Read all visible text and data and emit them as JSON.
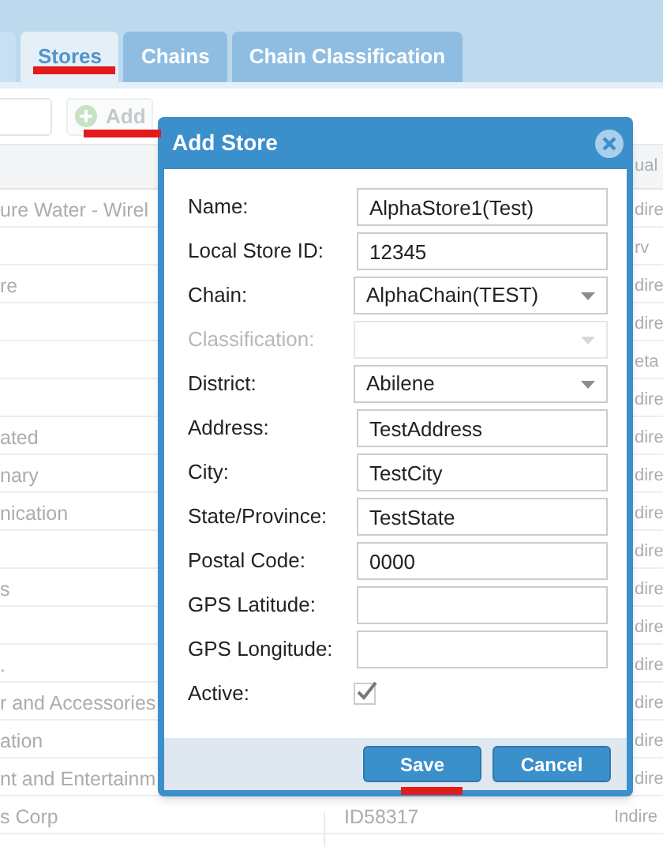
{
  "tabs": [
    {
      "label": "Stores",
      "selected": true
    },
    {
      "label": "Chains",
      "selected": false
    },
    {
      "label": "Chain Classification",
      "selected": false
    }
  ],
  "toolbar": {
    "add_button": "Add"
  },
  "grid": {
    "header_col_3": "ual",
    "rows": [
      {
        "col_1": "ure Water - Wirel",
        "col_3": "dire"
      },
      {
        "col_3": "rv"
      },
      {
        "col_1": "re",
        "col_3": "dire"
      },
      {
        "col_3": "dire"
      },
      {
        "col_3": "eta"
      },
      {
        "col_3": "dire"
      },
      {
        "col_1": "ated",
        "col_3": "dire"
      },
      {
        "col_1": "nary",
        "col_3": "dire"
      },
      {
        "col_1": "nication",
        "col_3": "dire"
      },
      {
        "col_3": "dire"
      },
      {
        "col_1": "s",
        "col_3": "dire"
      },
      {
        "col_3": "dire"
      },
      {
        "col_1": ".",
        "col_3": "dire"
      },
      {
        "col_1": "r and Accessories",
        "col_3": "dire"
      },
      {
        "col_1": "ation",
        "col_3": "dire"
      },
      {
        "col_1": "nt and Entertainm",
        "col_3": "dire"
      },
      {
        "col_1": "s Corp",
        "col_2": "ID58317",
        "col_3": "Indire"
      }
    ]
  },
  "dialog": {
    "title": "Add Store",
    "fields": [
      {
        "kind": "text",
        "label": "Name:",
        "value": "AlphaStore1(Test)",
        "disabled": false
      },
      {
        "kind": "text",
        "label": "Local Store ID:",
        "value": "12345",
        "disabled": false
      },
      {
        "kind": "select",
        "label": "Chain:",
        "value": "AlphaChain(TEST)",
        "disabled": false
      },
      {
        "kind": "select",
        "label": "Classification:",
        "disabled": true
      },
      {
        "kind": "select",
        "label": "District:",
        "value": "Abilene",
        "disabled": false
      },
      {
        "kind": "text",
        "label": "Address:",
        "value": "TestAddress",
        "disabled": false
      },
      {
        "kind": "text",
        "label": "City:",
        "value": "TestCity",
        "disabled": false
      },
      {
        "kind": "text",
        "label": "State/Province:",
        "value": "TestState",
        "disabled": false
      },
      {
        "kind": "text",
        "label": "Postal Code:",
        "value": "0000",
        "disabled": false
      },
      {
        "kind": "text",
        "label": "GPS Latitude:",
        "disabled": false
      },
      {
        "kind": "text",
        "label": "GPS Longitude:",
        "disabled": false
      },
      {
        "kind": "checkbox",
        "label": "Active:",
        "checked": true,
        "disabled": false
      }
    ],
    "buttons": [
      "Save",
      "Cancel"
    ]
  }
}
